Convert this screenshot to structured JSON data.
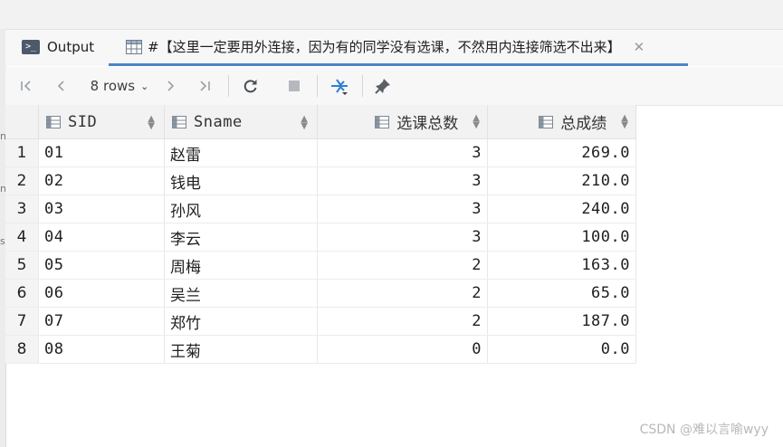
{
  "tabs": {
    "output_label": "Output",
    "result_label": "#【这里一定要用外连接，因为有的同学没有选课，不然用内连接筛选不出来】",
    "close_symbol": "✕"
  },
  "toolbar": {
    "rows_label": "8 rows"
  },
  "table": {
    "columns": [
      "SID",
      "Sname",
      "选课总数",
      "总成绩"
    ],
    "rows": [
      {
        "n": "1",
        "sid": "01",
        "name": "赵雷",
        "count": "3",
        "total": "269.0"
      },
      {
        "n": "2",
        "sid": "02",
        "name": "钱电",
        "count": "3",
        "total": "210.0"
      },
      {
        "n": "3",
        "sid": "03",
        "name": "孙风",
        "count": "3",
        "total": "240.0"
      },
      {
        "n": "4",
        "sid": "04",
        "name": "李云",
        "count": "3",
        "total": "100.0"
      },
      {
        "n": "5",
        "sid": "05",
        "name": "周梅",
        "count": "2",
        "total": "163.0"
      },
      {
        "n": "6",
        "sid": "06",
        "name": "吴兰",
        "count": "2",
        "total": "65.0"
      },
      {
        "n": "7",
        "sid": "07",
        "name": "郑竹",
        "count": "2",
        "total": "187.0"
      },
      {
        "n": "8",
        "sid": "08",
        "name": "王菊",
        "count": "0",
        "total": "0.0"
      }
    ]
  },
  "gutter_marks": [
    "n",
    "n",
    "s"
  ],
  "watermark": "CSDN @难以言喻wyy",
  "colors": {
    "accent": "#4a86c7",
    "header_bg": "#f2f2f2"
  }
}
